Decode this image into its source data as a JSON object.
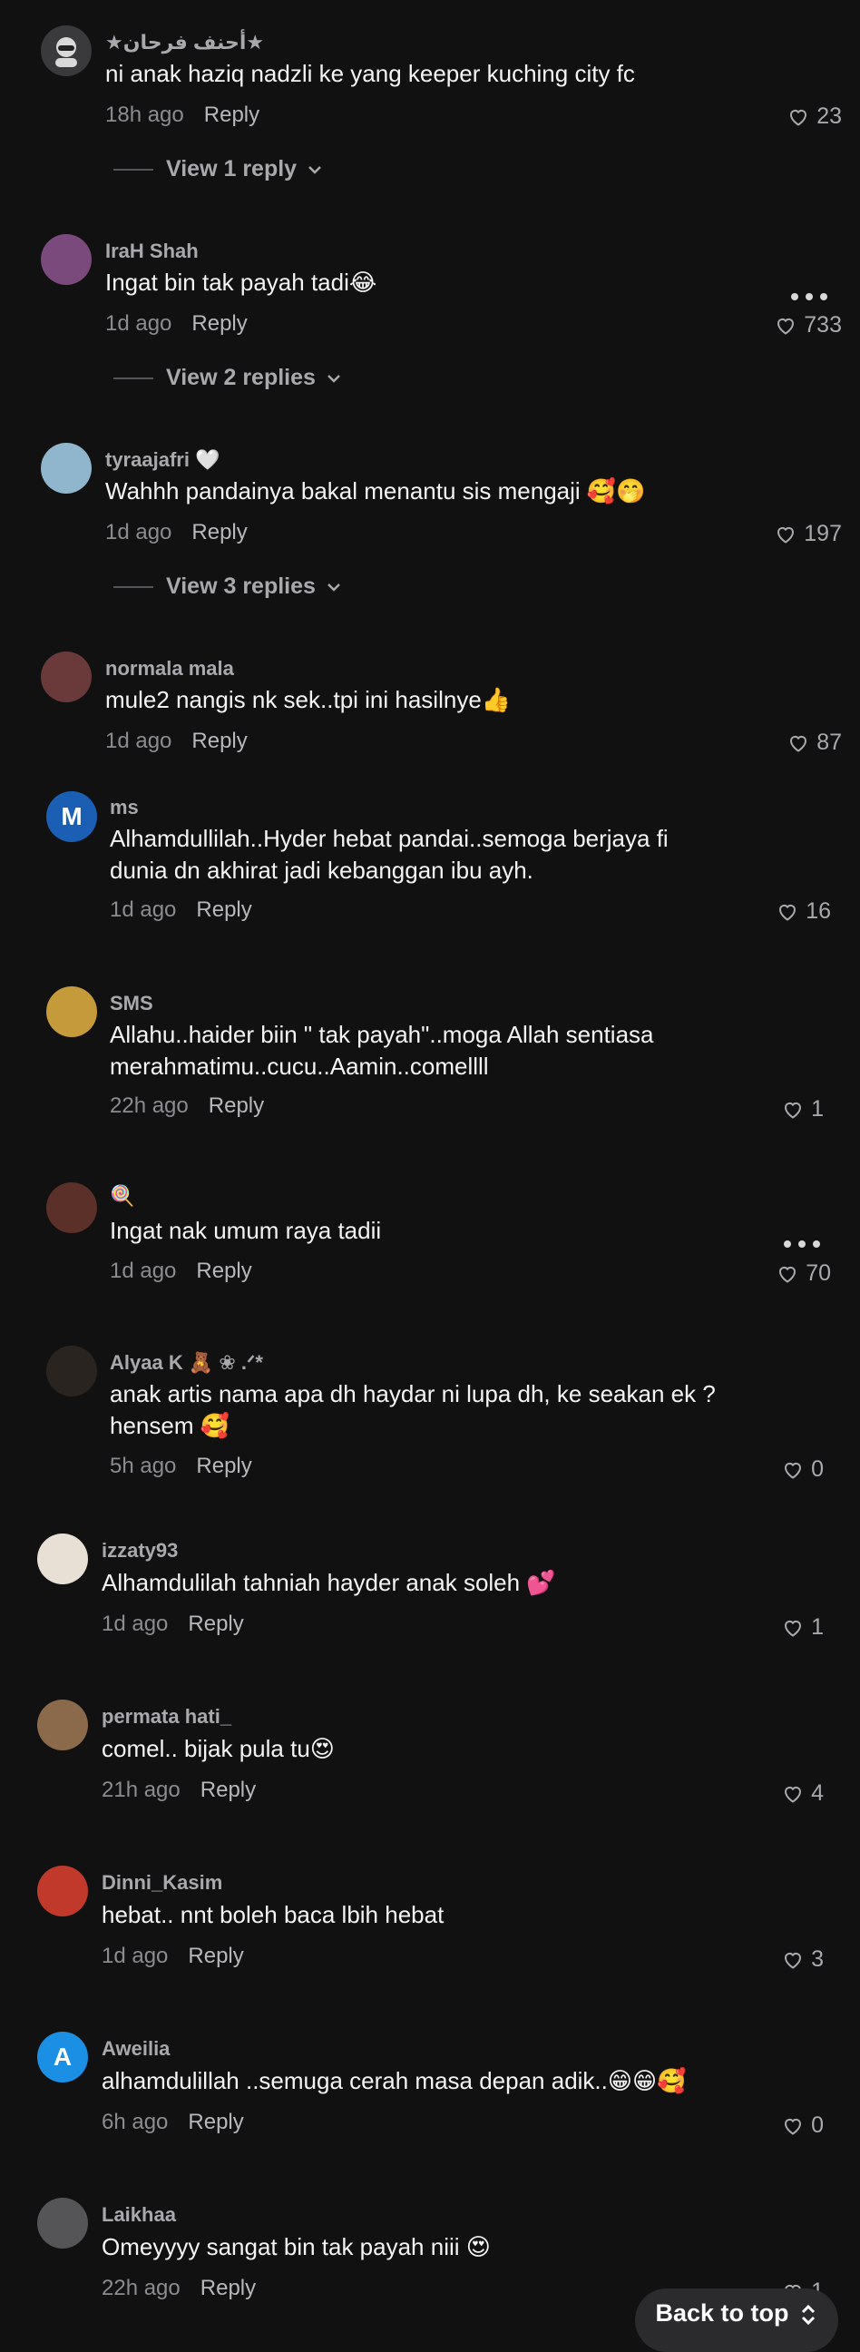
{
  "comments": [
    {
      "username": "★أحنف فرحان★",
      "text": "ni anak haziq nadzli ke yang keeper kuching city fc",
      "time": "18h ago",
      "reply": "Reply",
      "likes": "23",
      "view_replies": "View 1 reply",
      "avatar_color": "#3a3a3d",
      "avatar_icon": "mask-avatar-icon"
    },
    {
      "username": "IraH Shah",
      "text": "Ingat bin tak payah tadi😂",
      "time": "1d ago",
      "reply": "Reply",
      "likes": "733",
      "view_replies": "View 2 replies",
      "avatar_color": "#7a4a7d"
    },
    {
      "username": "tyraajafri 🤍",
      "text": "Wahhh pandainya bakal menantu sis mengaji 🥰🤭",
      "time": "1d ago",
      "reply": "Reply",
      "likes": "197",
      "view_replies": "View 3 replies",
      "avatar_color": "#8fb6cc"
    },
    {
      "username": "normala mala",
      "text": "mule2 nangis nk sek..tpi ini hasilnye👍",
      "time": "1d ago",
      "reply": "Reply",
      "likes": "87",
      "avatar_color": "#6a3a3a"
    },
    {
      "username": "ms",
      "text": "Alhamdullilah..Hyder hebat pandai..semoga berjaya fi dunia dn akhirat jadi kebanggan ibu ayh.",
      "time": "1d ago",
      "reply": "Reply",
      "likes": "16",
      "avatar_color": "#1a5fb4",
      "avatar_letter": "M"
    },
    {
      "username": "SMS",
      "text": "Allahu..haider biin \" tak payah\"..moga Allah sentiasa merahmatimu..cucu..Aamin..comellll",
      "time": "22h ago",
      "reply": "Reply",
      "likes": "1",
      "avatar_color": "#c49a3a"
    },
    {
      "username": "🍭",
      "text": "Ingat nak umum raya tadii",
      "time": "1d ago",
      "reply": "Reply",
      "likes": "70",
      "avatar_color": "#5a3028"
    },
    {
      "username": "Alyaa K 🧸 ❀ .ᐟ*",
      "text": "anak artis nama apa dh haydar ni lupa dh, ke seakan ek ? hensem 🥰",
      "time": "5h ago",
      "reply": "Reply",
      "likes": "0",
      "avatar_color": "#2a2420"
    },
    {
      "username": "izzaty93",
      "text": "Alhamdulilah tahniah hayder anak soleh 💕",
      "time": "1d ago",
      "reply": "Reply",
      "likes": "1",
      "avatar_color": "#e8e0d4"
    },
    {
      "username": "permata hati_",
      "text": "comel.. bijak pula tu😍",
      "time": "21h ago",
      "reply": "Reply",
      "likes": "4",
      "avatar_color": "#8a6a4a"
    },
    {
      "username": "Dinni_Kasim",
      "text": "hebat.. nnt boleh baca lbih hebat",
      "time": "1d ago",
      "reply": "Reply",
      "likes": "3",
      "avatar_color": "#c0392b"
    },
    {
      "username": "Aweilia",
      "text": "alhamdulillah ..semuga cerah masa depan adik..😁😁🥰",
      "time": "6h ago",
      "reply": "Reply",
      "likes": "0",
      "avatar_color": "#1a8fe3",
      "avatar_letter": "A"
    },
    {
      "username": "Laikhaa",
      "text": "Omeyyyy sangat bin tak payah niii 😍",
      "time": "22h ago",
      "reply": "Reply",
      "likes": "1",
      "avatar_color": "#555558"
    }
  ],
  "back_to_top": "Back to top",
  "icons": {
    "like": "heart-outline-icon",
    "more": "more-dots-icon",
    "chevron": "chevron-down-icon",
    "back_to_top": "up-down-arrows-icon"
  }
}
